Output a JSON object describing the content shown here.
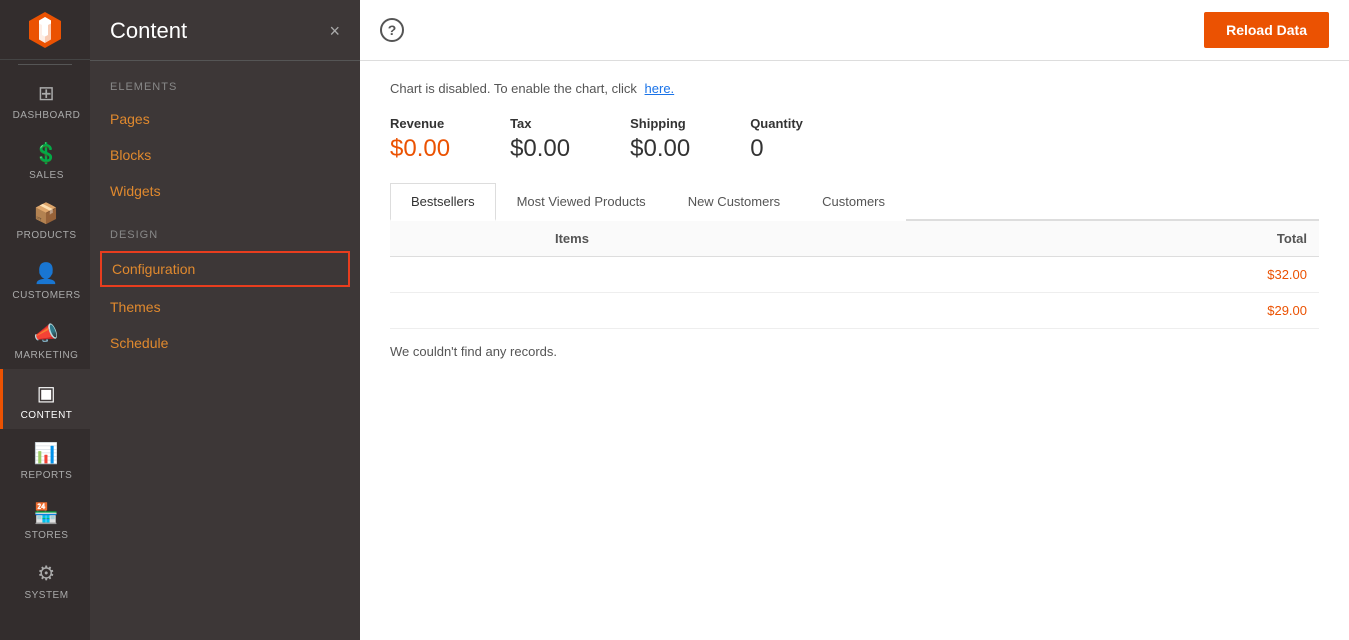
{
  "nav_rail": {
    "items": [
      {
        "id": "dashboard",
        "label": "DASHBOARD",
        "icon": "⊞",
        "active": false
      },
      {
        "id": "sales",
        "label": "SALES",
        "icon": "$",
        "active": false
      },
      {
        "id": "products",
        "label": "PRODUCTS",
        "icon": "⬡",
        "active": false
      },
      {
        "id": "customers",
        "label": "CUSTOMERS",
        "icon": "👤",
        "active": false
      },
      {
        "id": "marketing",
        "label": "MARKETING",
        "icon": "📣",
        "active": false
      },
      {
        "id": "content",
        "label": "CONTENT",
        "icon": "▣",
        "active": true
      },
      {
        "id": "reports",
        "label": "REPORTS",
        "icon": "📊",
        "active": false
      },
      {
        "id": "stores",
        "label": "STORES",
        "icon": "🏪",
        "active": false
      },
      {
        "id": "system",
        "label": "SYSTEM",
        "icon": "⚙",
        "active": false
      }
    ]
  },
  "sidebar": {
    "title": "Content",
    "close_label": "×",
    "sections": [
      {
        "label": "Elements",
        "items": [
          {
            "id": "pages",
            "label": "Pages"
          },
          {
            "id": "blocks",
            "label": "Blocks"
          },
          {
            "id": "widgets",
            "label": "Widgets"
          }
        ]
      },
      {
        "label": "Design",
        "items": [
          {
            "id": "configuration",
            "label": "Configuration",
            "highlighted": true
          },
          {
            "id": "themes",
            "label": "Themes"
          },
          {
            "id": "schedule",
            "label": "Schedule"
          }
        ]
      }
    ]
  },
  "top_bar": {
    "help_icon": "?",
    "reload_button": "Reload Data"
  },
  "dashboard": {
    "chart_notice": "Chart is disabled. To enable the chart, click",
    "chart_notice_link": "here.",
    "stats": [
      {
        "label": "Revenue",
        "value": "$0.00",
        "orange": true
      },
      {
        "label": "Tax",
        "value": "$0.00",
        "orange": false
      },
      {
        "label": "Shipping",
        "value": "$0.00",
        "orange": false
      },
      {
        "label": "Quantity",
        "value": "0",
        "orange": false
      }
    ],
    "tabs": [
      {
        "id": "bestsellers",
        "label": "Bestsellers",
        "active": true
      },
      {
        "id": "most-viewed",
        "label": "Most Viewed Products",
        "active": false
      },
      {
        "id": "new-customers",
        "label": "New Customers",
        "active": false
      },
      {
        "id": "customers",
        "label": "Customers",
        "active": false
      }
    ],
    "table": {
      "headers": [
        "",
        "Items",
        "Total"
      ],
      "rows": [
        {
          "items": "",
          "total": "$32.00"
        },
        {
          "items": "",
          "total": "$29.00"
        }
      ]
    },
    "no_records_message": "We couldn't find any records."
  }
}
